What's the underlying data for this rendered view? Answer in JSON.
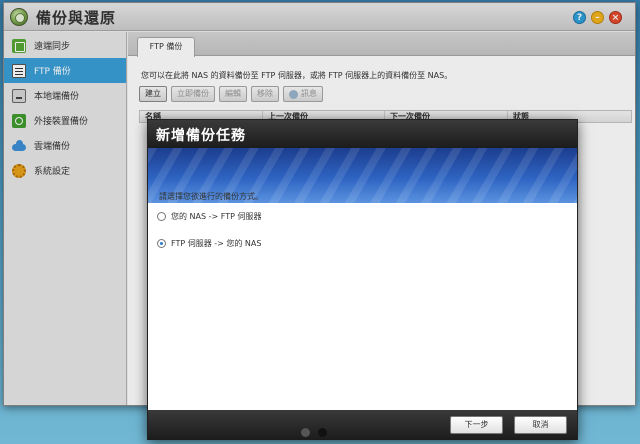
{
  "app": {
    "title": "備份與還原",
    "icon": "backup-app-icon",
    "window_buttons": [
      "help-icon",
      "minimize-icon",
      "close-icon"
    ]
  },
  "sidebar": {
    "items": [
      {
        "label": "遠端同步",
        "icon": "sync-icon",
        "active": false
      },
      {
        "label": "FTP 備份",
        "icon": "ftp-icon",
        "active": true
      },
      {
        "label": "本地端備份",
        "icon": "local-disk-icon",
        "active": false
      },
      {
        "label": "外接裝置備份",
        "icon": "external-device-icon",
        "active": false
      },
      {
        "label": "雲端備份",
        "icon": "cloud-icon",
        "active": false
      },
      {
        "label": "系統設定",
        "icon": "gear-icon",
        "active": false
      }
    ]
  },
  "main": {
    "tab": "FTP 備份",
    "description": "您可以在此將 NAS 的資料備份至 FTP 伺服器，或將 FTP 伺服器上的資料備份至 NAS。",
    "toolbar": {
      "create": "建立",
      "backup_now": "立即備份",
      "edit": "編輯",
      "remove": "移除",
      "info": "訊息"
    },
    "table_headers": [
      "名稱",
      "上一次備份",
      "下一次備份",
      "狀態"
    ]
  },
  "modal": {
    "title": "新增備份任務",
    "prompt": "請選擇您欲進行的備份方式。",
    "options": [
      {
        "label": "您的 NAS -> FTP 伺服器",
        "checked": false
      },
      {
        "label": "FTP 伺服器 -> 您的 NAS",
        "checked": true
      }
    ],
    "next": "下一步",
    "cancel": "取消"
  },
  "colors": {
    "accent": "#3a9fd8",
    "modal_header": "#1c1c1c",
    "banner": "#2e64c2"
  }
}
